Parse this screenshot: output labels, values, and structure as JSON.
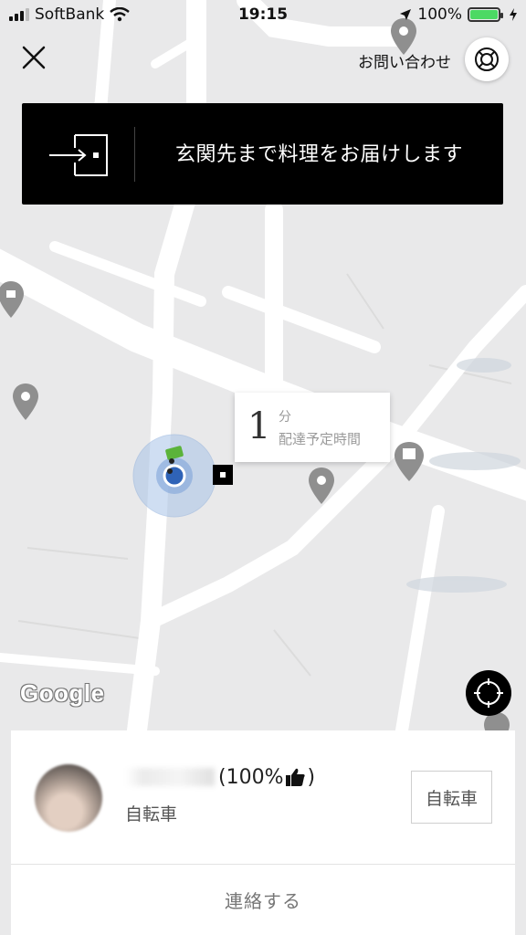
{
  "status_bar": {
    "carrier": "SoftBank",
    "time": "19:15",
    "battery": "100%",
    "icons": [
      "signal-bars-icon",
      "wifi-icon",
      "location-arrow-icon",
      "battery-icon",
      "charging-bolt-icon"
    ]
  },
  "header": {
    "close_icon": "close-icon",
    "help_label": "お問い合わせ",
    "help_icon": "lifebuoy-icon"
  },
  "banner": {
    "icon": "door-enter-icon",
    "text": "玄関先まで料理をお届けします"
  },
  "eta": {
    "minutes": "1",
    "unit": "分",
    "label": "配達予定時間"
  },
  "map": {
    "attribution": "Google",
    "locate_icon": "recenter-icon",
    "colors": {
      "background": "#e9e9ea",
      "road": "#ffffff",
      "pin": "#8f8f8f",
      "courier_ring": "#a9c4e8",
      "courier_dot": "#2f63b7",
      "bike": "#5bb33a"
    }
  },
  "courier": {
    "rating": "(100%",
    "rating_close": ")",
    "rating_icon": "thumbs-up-icon",
    "vehicle": "自転車",
    "vehicle_button": "自転車"
  },
  "actions": {
    "contact": "連絡する"
  }
}
